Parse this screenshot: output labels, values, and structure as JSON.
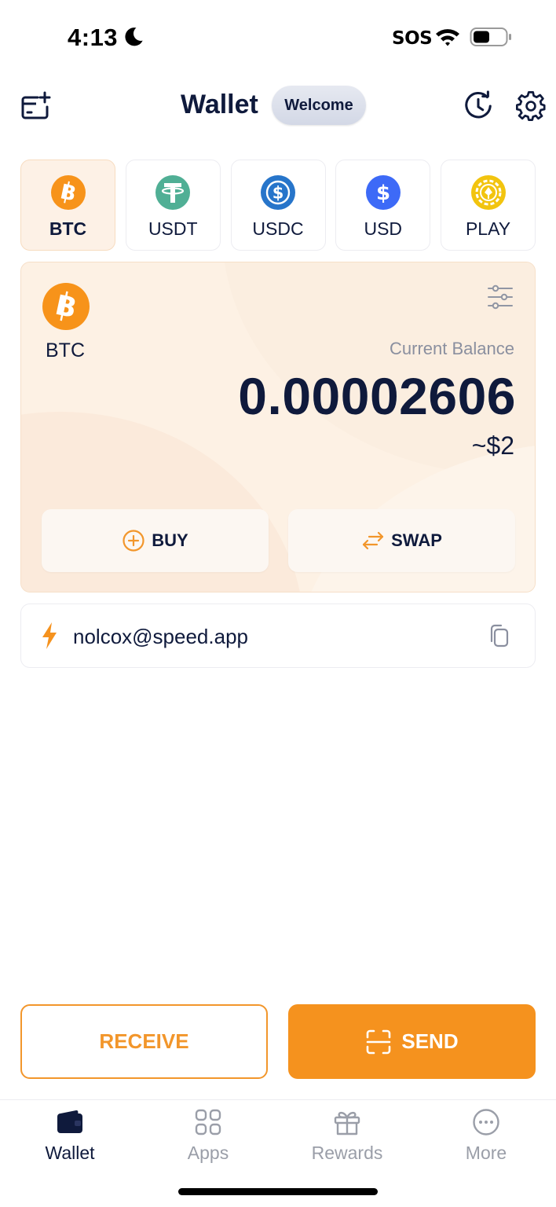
{
  "status_bar": {
    "time": "4:13",
    "carrier": "SOS",
    "icons": [
      "moon-icon",
      "wifi-icon",
      "battery-icon"
    ]
  },
  "header": {
    "title": "Wallet",
    "badge": "Welcome",
    "icons": [
      "add-card-icon",
      "history-icon",
      "settings-icon"
    ]
  },
  "currencies": [
    {
      "label": "BTC",
      "icon": "bitcoin-icon",
      "color": "#F7931A",
      "active": true
    },
    {
      "label": "USDT",
      "icon": "tether-icon",
      "color": "#50AF95",
      "active": false
    },
    {
      "label": "USDC",
      "icon": "usdc-icon",
      "color": "#2775CA",
      "active": false
    },
    {
      "label": "USD",
      "icon": "dollar-icon",
      "color": "#3D6AF7",
      "active": false
    },
    {
      "label": "PLAY",
      "icon": "play-token-icon",
      "color": "#F2C40F",
      "active": false
    }
  ],
  "balance": {
    "currency": "BTC",
    "label": "Current Balance",
    "amount": "0.00002606",
    "fiat": "~$2",
    "buy_label": "BUY",
    "swap_label": "SWAP"
  },
  "address": {
    "value": "nolcox@speed.app"
  },
  "actions": {
    "receive_label": "RECEIVE",
    "send_label": "SEND"
  },
  "nav": [
    {
      "label": "Wallet",
      "icon": "wallet-icon",
      "active": true
    },
    {
      "label": "Apps",
      "icon": "apps-icon",
      "active": false
    },
    {
      "label": "Rewards",
      "icon": "gift-icon",
      "active": false
    },
    {
      "label": "More",
      "icon": "more-icon",
      "active": false
    }
  ],
  "colors": {
    "accent": "#F5921E",
    "navy": "#0F1A3C",
    "card_bg": "#FDF1E4"
  }
}
